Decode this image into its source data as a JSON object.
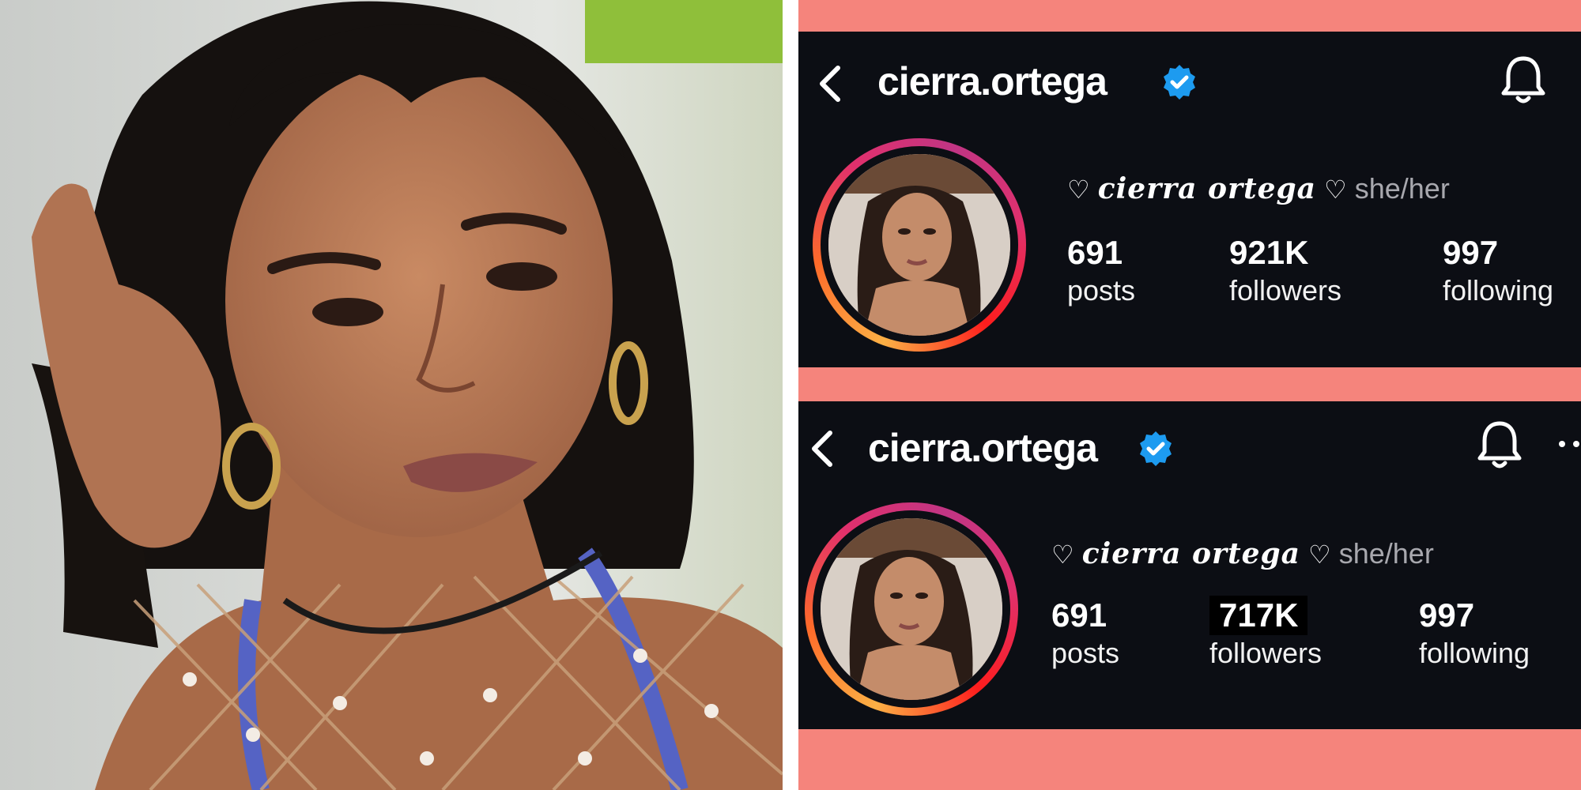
{
  "profiles": [
    {
      "username": "cierra.ortega",
      "bio": {
        "heart_left": "♡",
        "display_name": "cierra ortega",
        "heart_right": "♡",
        "pronouns": "she/her"
      },
      "stats": [
        {
          "value": "691",
          "label": "posts"
        },
        {
          "value": "921K",
          "label": "followers"
        },
        {
          "value": "997",
          "label": "following"
        }
      ],
      "icons": [
        "back-chevron-icon",
        "verified-badge-icon",
        "bell-icon"
      ]
    },
    {
      "username": "cierra.ortega",
      "bio": {
        "heart_left": "♡",
        "display_name": "cierra ortega",
        "heart_right": "♡",
        "pronouns": "she/her"
      },
      "stats": [
        {
          "value": "691",
          "label": "posts"
        },
        {
          "value": "717K",
          "label": "followers"
        },
        {
          "value": "997",
          "label": "following"
        }
      ],
      "icons": [
        "back-chevron-icon",
        "verified-badge-icon",
        "bell-icon",
        "more-icon"
      ]
    }
  ],
  "colors": {
    "background_accent": "#f5847c",
    "card_background": "#0c0e14",
    "verified_blue": "#1d9bf0",
    "pronoun_gray": "#a8a8ae"
  }
}
